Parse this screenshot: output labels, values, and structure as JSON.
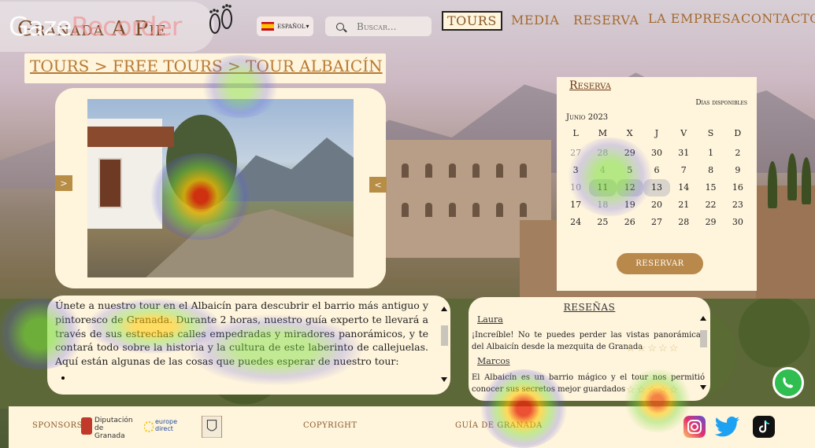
{
  "nav": {
    "logo": "Granada A Pie",
    "language": "ESPAÑOL",
    "search_placeholder": "Buscar...",
    "items": [
      "TOURS",
      "MEDIA",
      "RESERVA",
      "LA EMPRESA",
      "CONTACTO"
    ]
  },
  "overlay": {
    "part1": "Gaze",
    "part2": "Recorder"
  },
  "breadcrumb": "TOURS > FREE TOURS > TOUR ALBAICÍN",
  "carousel": {
    "prev": ">",
    "next": "<"
  },
  "calendar": {
    "title": "Reserva",
    "legend": "Días disponibles",
    "month": "Junio 2023",
    "weekdays": [
      "L",
      "M",
      "X",
      "J",
      "V",
      "S",
      "D"
    ],
    "days": [
      {
        "d": "27",
        "s": "muted"
      },
      {
        "d": "28",
        "s": "muted"
      },
      {
        "d": "29",
        "s": ""
      },
      {
        "d": "30",
        "s": ""
      },
      {
        "d": "31",
        "s": ""
      },
      {
        "d": "1",
        "s": ""
      },
      {
        "d": "2",
        "s": ""
      },
      {
        "d": "3",
        "s": ""
      },
      {
        "d": "4",
        "s": "muted"
      },
      {
        "d": "5",
        "s": ""
      },
      {
        "d": "6",
        "s": ""
      },
      {
        "d": "7",
        "s": ""
      },
      {
        "d": "8",
        "s": ""
      },
      {
        "d": "9",
        "s": ""
      },
      {
        "d": "10",
        "s": "muted"
      },
      {
        "d": "11",
        "s": "avail"
      },
      {
        "d": "12",
        "s": "avail"
      },
      {
        "d": "13",
        "s": "avail"
      },
      {
        "d": "14",
        "s": ""
      },
      {
        "d": "15",
        "s": ""
      },
      {
        "d": "16",
        "s": ""
      },
      {
        "d": "17",
        "s": ""
      },
      {
        "d": "18",
        "s": "muted"
      },
      {
        "d": "19",
        "s": ""
      },
      {
        "d": "20",
        "s": ""
      },
      {
        "d": "21",
        "s": ""
      },
      {
        "d": "22",
        "s": ""
      },
      {
        "d": "23",
        "s": ""
      },
      {
        "d": "24",
        "s": ""
      },
      {
        "d": "25",
        "s": ""
      },
      {
        "d": "26",
        "s": ""
      },
      {
        "d": "27",
        "s": ""
      },
      {
        "d": "28",
        "s": ""
      },
      {
        "d": "29",
        "s": ""
      },
      {
        "d": "30",
        "s": ""
      }
    ],
    "button": "RESERVAR"
  },
  "description": {
    "text": "Únete a nuestro tour en el Albaicín para descubrir el barrio más antiguo y pintoresco de Granada. Durante 2 horas, nuestro guía experto te llevará a través de sus estrechas calles empedradas y miradores panorámicos, y te contará todo sobre la historia y la cultura de este laberinto de callejuelas. Aquí están algunas de las cosas que puedes esperar de nuestro tour:",
    "bullet": ""
  },
  "reviews": {
    "title": "RESEÑAS",
    "items": [
      {
        "name": "Laura",
        "text": "¡Increíble! No te puedes perder las vistas panorámicas del Albaicín desde la mezquita de Granada",
        "stars": "☆☆☆☆☆"
      },
      {
        "name": "Marcos",
        "text": "El Albaicín es un barrio mágico y el tour nos permitió conocer sus secretos mejor guardados",
        "stars": "☆☆☆☆☆"
      }
    ]
  },
  "footer": {
    "sponsors": "SPONSORS",
    "sponsor1_line1": "Diputación",
    "sponsor1_line2": "de Granada",
    "sponsor2_line1": "europe",
    "sponsor2_line2": "direct",
    "copyright": "COPYRIGHT",
    "guide": "GUÍA DE GRANADA"
  },
  "colors": {
    "accent": "#a36a30",
    "panel": "#fff4dc",
    "button": "#b8894a"
  }
}
